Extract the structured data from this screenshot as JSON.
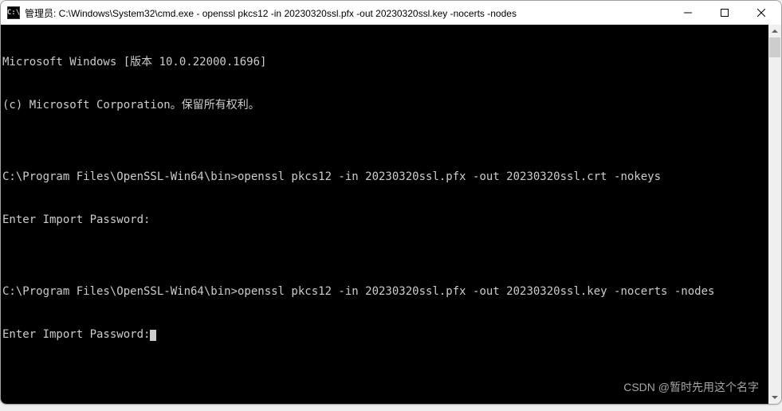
{
  "titlebar": {
    "icon_label": "C:\\",
    "title": "管理员: C:\\Windows\\System32\\cmd.exe - openssl  pkcs12 -in 20230320ssl.pfx -out 20230320ssl.key -nocerts -nodes"
  },
  "terminal": {
    "lines": [
      "Microsoft Windows [版本 10.0.22000.1696]",
      "(c) Microsoft Corporation。保留所有权利。",
      "",
      "C:\\Program Files\\OpenSSL-Win64\\bin>openssl pkcs12 -in 20230320ssl.pfx -out 20230320ssl.crt -nokeys",
      "Enter Import Password:",
      "",
      "C:\\Program Files\\OpenSSL-Win64\\bin>openssl pkcs12 -in 20230320ssl.pfx -out 20230320ssl.key -nocerts -nodes",
      "Enter Import Password:"
    ]
  },
  "watermark": "CSDN @暂时先用这个名字"
}
